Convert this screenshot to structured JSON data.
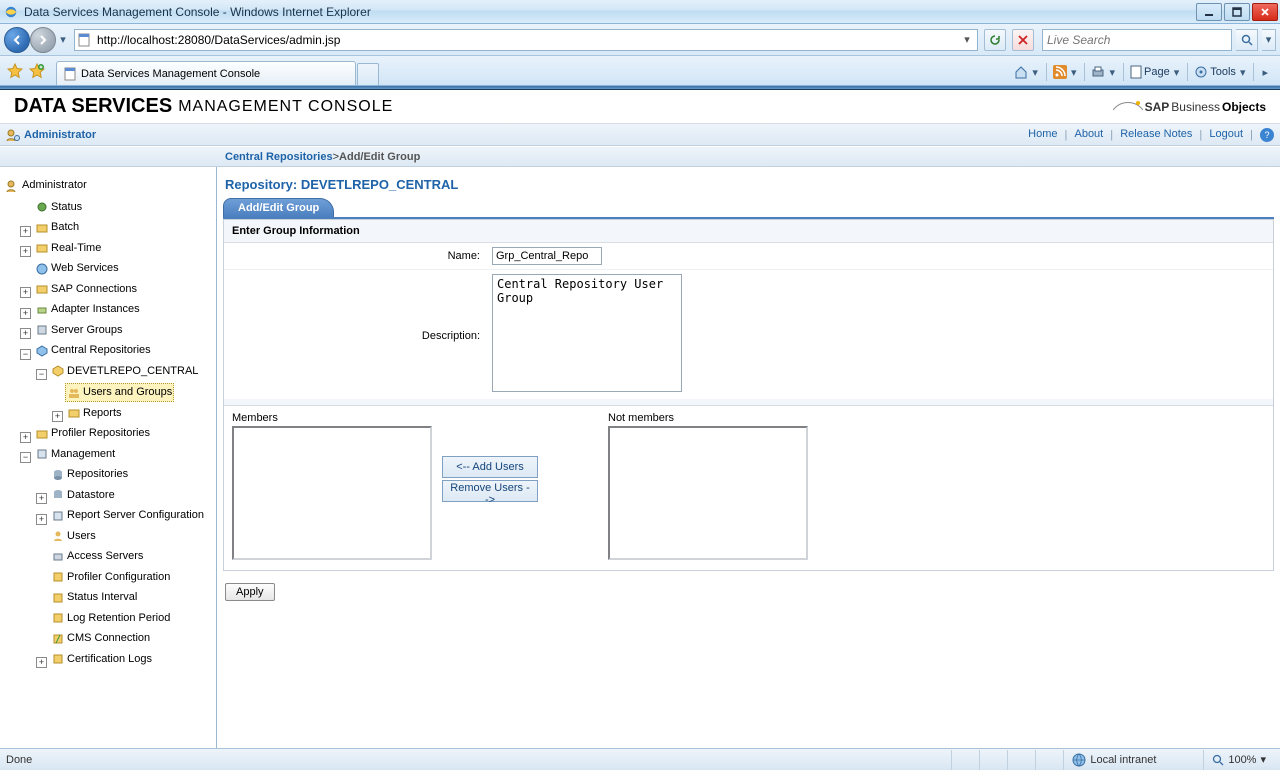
{
  "window": {
    "title": "Data Services Management Console - Windows Internet Explorer"
  },
  "nav": {
    "url": "http://localhost:28080/DataServices/admin.jsp",
    "search_placeholder": "Live Search"
  },
  "tabs": {
    "active": "Data Services Management Console"
  },
  "cmdbar": {
    "page": "Page",
    "tools": "Tools"
  },
  "app_header": {
    "title_main": "DATA SERVICES",
    "title_sub": "MANAGEMENT CONSOLE",
    "brand_prefix": "SAP",
    "brand_mid": "Business",
    "brand_suffix": "Objects"
  },
  "admin_bar": {
    "label": "Administrator",
    "links": {
      "home": "Home",
      "about": "About",
      "release_notes": "Release Notes",
      "logout": "Logout"
    }
  },
  "breadcrumb": {
    "root": "Central Repositories",
    "sep": " > ",
    "current": "Add/Edit Group"
  },
  "repo": {
    "label": "Repository: DEVETLREPO_CENTRAL"
  },
  "formtab": "Add/Edit Group",
  "form": {
    "section": "Enter Group Information",
    "name_label": "Name:",
    "name_value": "Grp_Central_Repo",
    "desc_label": "Description:",
    "desc_value": "Central Repository User Group",
    "members_label": "Members",
    "notmembers_label": "Not members",
    "add_users_btn": "<-- Add Users",
    "remove_users_btn": "Remove Users -->",
    "apply_btn": "Apply"
  },
  "tree": {
    "root": "Administrator",
    "status": "Status",
    "batch": "Batch",
    "realtime": "Real-Time",
    "webservices": "Web Services",
    "sapconn": "SAP Connections",
    "adapter": "Adapter Instances",
    "servergroups": "Server Groups",
    "centralrepos": "Central Repositories",
    "devetl": "DEVETLREPO_CENTRAL",
    "usersgroups": "Users and Groups",
    "reports": "Reports",
    "profiler": "Profiler Repositories",
    "management": "Management",
    "repositories": "Repositories",
    "datastore": "Datastore",
    "reportserver": "Report Server Configuration",
    "users": "Users",
    "accessservers": "Access Servers",
    "profilercfg": "Profiler Configuration",
    "statusinterval": "Status Interval",
    "logretention": "Log Retention Period",
    "cmsconn": "CMS Connection",
    "certlogs": "Certification Logs"
  },
  "status": {
    "text": "Done",
    "zone": "Local intranet",
    "zoom": "100%"
  }
}
